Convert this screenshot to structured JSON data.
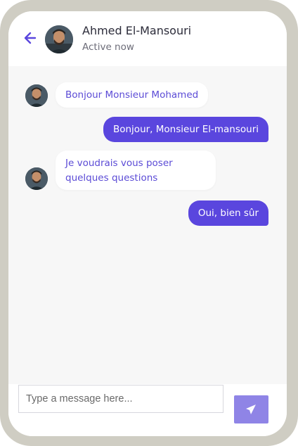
{
  "header": {
    "contact_name": "Ahmed El-Mansouri",
    "status": "Active now"
  },
  "messages": [
    {
      "direction": "incoming",
      "text": "Bonjour Monsieur Mohamed"
    },
    {
      "direction": "outgoing",
      "text": "Bonjour, Monsieur El-mansouri"
    },
    {
      "direction": "incoming",
      "text": "Je voudrais vous poser quelques questions"
    },
    {
      "direction": "outgoing",
      "text": "Oui, bien sûr"
    }
  ],
  "composer": {
    "placeholder": "Type a message here..."
  },
  "icons": {
    "back": "arrow-left-icon",
    "send": "paper-plane-icon"
  },
  "colors": {
    "accent": "#5a46de",
    "send_button": "#8f84e6",
    "incoming_text": "#5b4bd6",
    "frame": "#cfcdc3"
  }
}
